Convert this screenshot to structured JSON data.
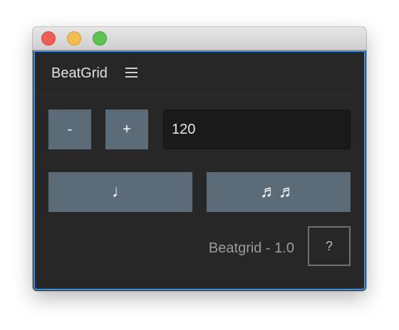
{
  "window": {
    "controls": {
      "close_icon": "close-dot-icon",
      "minimize_icon": "minimize-dot-icon",
      "maximize_icon": "maximize-dot-icon",
      "colors": {
        "close": "#ee5e57",
        "minimize": "#f5bd4f",
        "maximize": "#5cc352"
      }
    }
  },
  "header": {
    "title": "BeatGrid",
    "menu_icon": "hamburger-menu-icon"
  },
  "tempo": {
    "decrease_label": "-",
    "increase_label": "+",
    "bpm_value": "120"
  },
  "grid_buttons": {
    "quarter_note_label": "♩",
    "sixteenth_notes_label": "♬♬"
  },
  "footer": {
    "version_text": "Beatgrid - 1.0",
    "help_label": "?"
  },
  "colors": {
    "accent_border": "#3d8fe6",
    "button_bg": "#5b6c78",
    "panel_bg": "#272727",
    "input_bg": "#1a1a1a"
  }
}
